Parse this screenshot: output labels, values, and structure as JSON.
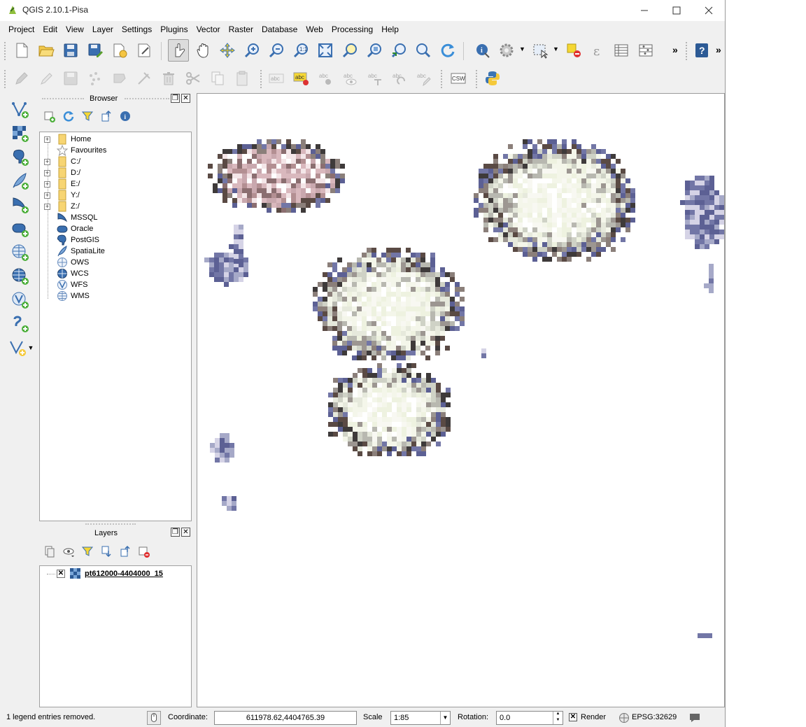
{
  "window": {
    "title": "QGIS 2.10.1-Pisa"
  },
  "menu": [
    "Project",
    "Edit",
    "View",
    "Layer",
    "Settings",
    "Plugins",
    "Vector",
    "Raster",
    "Database",
    "Web",
    "Processing",
    "Help"
  ],
  "toolbar": {
    "label_tool_text": "abc",
    "csw_text": "CSW",
    "overflow_glyph": "»"
  },
  "browser": {
    "title": "Browser",
    "items": [
      {
        "label": "Home",
        "icon": "folder-icon",
        "expandable": true
      },
      {
        "label": "Favourites",
        "icon": "star-icon",
        "expandable": false
      },
      {
        "label": "C:/",
        "icon": "folder-icon",
        "expandable": true
      },
      {
        "label": "D:/",
        "icon": "folder-icon",
        "expandable": true
      },
      {
        "label": "E:/",
        "icon": "folder-icon",
        "expandable": true
      },
      {
        "label": "Y:/",
        "icon": "folder-icon",
        "expandable": true
      },
      {
        "label": "Z:/",
        "icon": "folder-icon",
        "expandable": true
      },
      {
        "label": "MSSQL",
        "icon": "mssql-icon",
        "expandable": false
      },
      {
        "label": "Oracle",
        "icon": "oracle-icon",
        "expandable": false
      },
      {
        "label": "PostGIS",
        "icon": "postgis-icon",
        "expandable": false
      },
      {
        "label": "SpatiaLite",
        "icon": "spatialite-icon",
        "expandable": false
      },
      {
        "label": "OWS",
        "icon": "globe-icon",
        "expandable": false
      },
      {
        "label": "WCS",
        "icon": "globe-icon",
        "expandable": false
      },
      {
        "label": "WFS",
        "icon": "wfs-icon",
        "expandable": false
      },
      {
        "label": "WMS",
        "icon": "globe-icon",
        "expandable": false
      }
    ]
  },
  "layers": {
    "title": "Layers",
    "items": [
      {
        "name": "pt612000-4404000_15",
        "visible": true
      }
    ]
  },
  "status": {
    "message": "1 legend entries removed.",
    "coordinate_label": "Coordinate:",
    "coordinate_value": "611978.62,4404765.39",
    "scale_label": "Scale",
    "scale_value": "1:85",
    "rotation_label": "Rotation:",
    "rotation_value": "0.0",
    "render_label": "Render",
    "render_checked": true,
    "crs": "EPSG:32629"
  },
  "colors": {
    "accent": "#3e7bc4",
    "raster_light": "#f4f6ea",
    "raster_pink": "#d9b8bd",
    "raster_dark": "#5a4a44",
    "raster_blue": "#7276a6"
  }
}
